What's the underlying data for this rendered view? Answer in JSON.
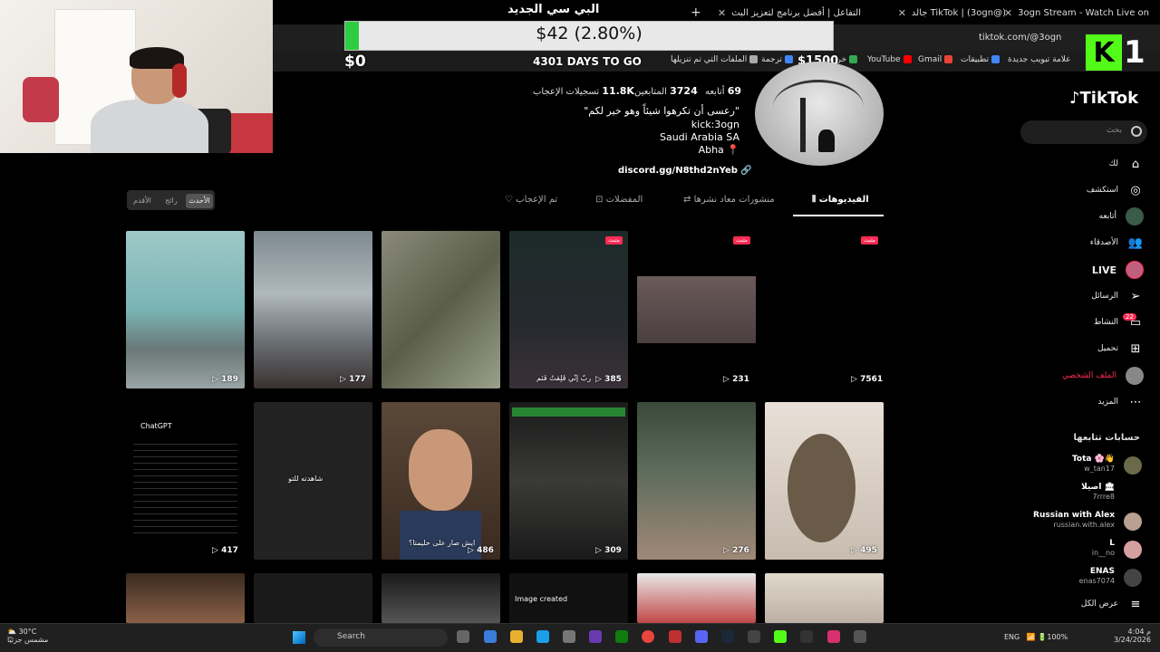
{
  "stream_overlay": {
    "title": "البي سي الجديد",
    "donation_amount": "$42 (2.80%)",
    "donation_progress": 0.028,
    "start_amount": "$0",
    "target_amount": "$1500",
    "days_left": "4301 DAYS TO GO",
    "kick_number": "1",
    "kick_letter": "K"
  },
  "browser": {
    "tabs": [
      {
        "label": "3ogn Stream - Watch Live on"
      },
      {
        "label": "TikTok | (3ogn@) جالد"
      },
      {
        "label": "التفاعل | أفضل برنامج لتعزيز البث"
      }
    ],
    "url": "tiktok.com/@3ogn",
    "bookmarks": [
      "علامة تبويب جديدة",
      "تطبيقات",
      "Gmail",
      "YouTube",
      "خرائط",
      "ترجمة",
      "الملفات التي تم تنزيلها"
    ]
  },
  "sidebar": {
    "logo": "TikTok",
    "search_placeholder": "بحث",
    "nav": [
      {
        "label": "لك",
        "icon": "home-icon"
      },
      {
        "label": "استكشف",
        "icon": "compass-icon"
      },
      {
        "label": "أتابعه",
        "icon": "following-avatar"
      },
      {
        "label": "الأصدقاء",
        "icon": "friends-icon"
      },
      {
        "label": "LIVE",
        "icon": "live-avatar"
      },
      {
        "label": "الرسائل",
        "icon": "send-icon"
      },
      {
        "label": "النشاط",
        "icon": "inbox-icon",
        "badge": "22"
      },
      {
        "label": "تحميل",
        "icon": "upload-icon"
      },
      {
        "label": "الملف الشخصي",
        "icon": "profile-avatar"
      },
      {
        "label": "المزيد",
        "icon": "more-icon"
      }
    ],
    "following_header": "حسابات تتابعها",
    "following": [
      {
        "name": "Tota 🌸👋",
        "handle": "w_tan17"
      },
      {
        "name": "اصيلا 🏛",
        "handle": "7rrre8"
      },
      {
        "name": "Russian with Alex",
        "handle": "russian.with.alex"
      },
      {
        "name": "L",
        "handle": "in__no"
      },
      {
        "name": "ENAS",
        "handle": "enas7074"
      }
    ],
    "see_all": "عرض الكل"
  },
  "profile": {
    "following_count": "69",
    "following_label": "أتابعه",
    "followers_count": "3724",
    "followers_label": "المتابعين",
    "likes_count": "11.8K",
    "likes_label": "تسجيلات الإعجاب",
    "bio": [
      "\"رعسى أن تكرهوا شيئاً وهو خير لكم\"",
      "kick:3ogn",
      "Saudi Arabia SA",
      "📍 Abha"
    ],
    "link": "discord.gg/N8thd2nYeb"
  },
  "tabs": [
    "الفيديوهات",
    "منشورات معاد نشرها",
    "المفضلات",
    "تم الإعجاب"
  ],
  "sort": [
    "الأحدث",
    "رائج",
    "الأقدم"
  ],
  "videos_row1": [
    {
      "views": "7561",
      "pinned": "مثبت"
    },
    {
      "views": "231",
      "pinned": "مثبت"
    },
    {
      "views": "385",
      "pinned": "مثبت",
      "caption": "ربّ إنّي قَلِقتُ فَنَم"
    },
    {
      "views": "",
      "pinned": ""
    },
    {
      "views": "177",
      "pinned": ""
    },
    {
      "views": "189",
      "pinned": ""
    }
  ],
  "videos_row2": [
    {
      "views": "495"
    },
    {
      "views": "276"
    },
    {
      "views": "309"
    },
    {
      "views": "486",
      "caption": "ايش صار على حليمتا؟"
    },
    {
      "views": "",
      "caption": "شاهدته للتو"
    },
    {
      "views": "417",
      "caption": "ChatGPT"
    }
  ],
  "row3_caption": "Image created",
  "taskbar": {
    "weather_temp": "30°C",
    "weather_desc": "مشمس جزئيًا",
    "search": "Search",
    "lang": "ENG",
    "battery": "100%",
    "time": "4:04 م",
    "date": "3/24/2026"
  }
}
